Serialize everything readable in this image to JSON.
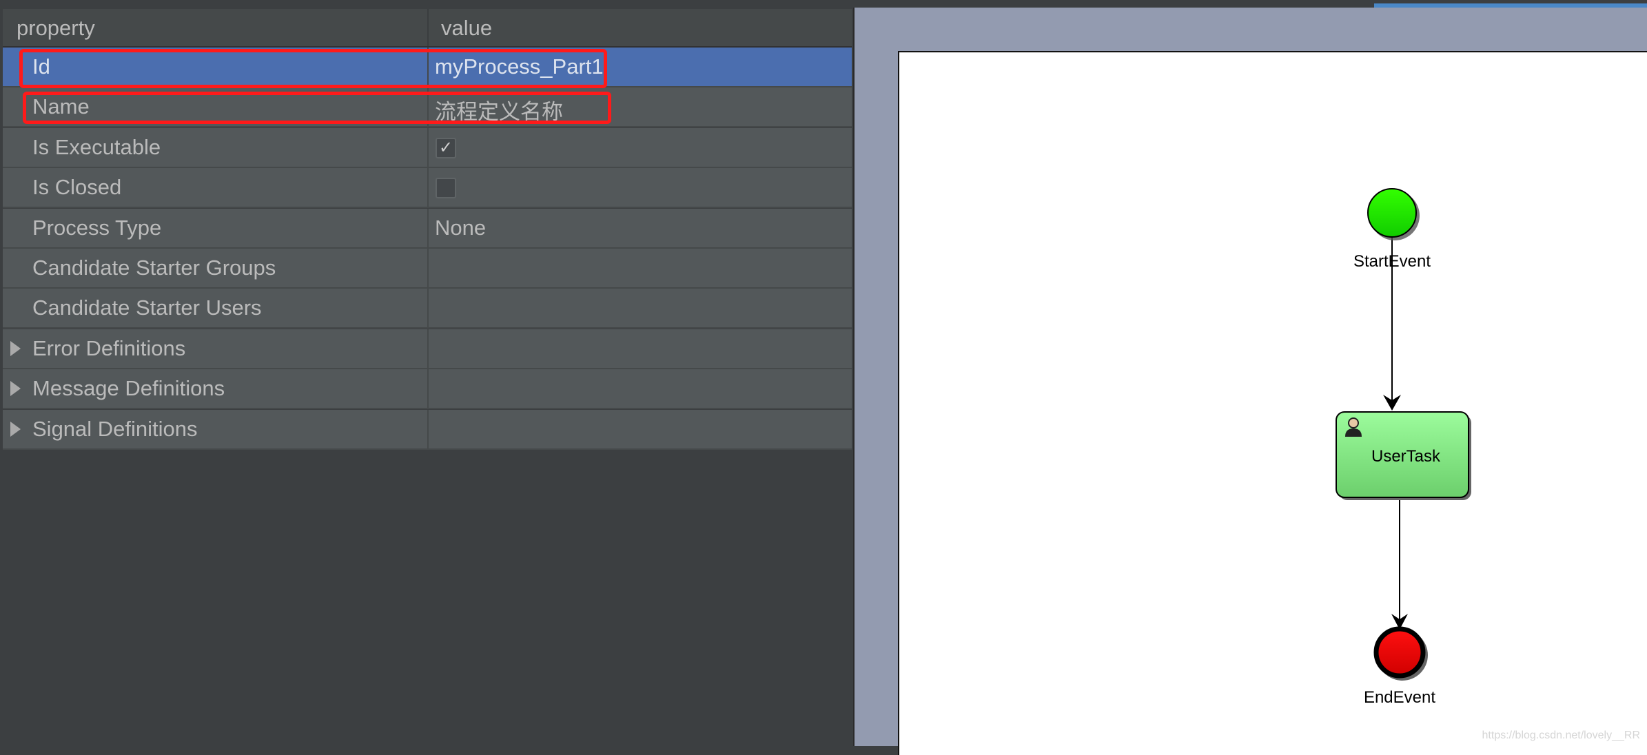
{
  "table": {
    "headers": {
      "property": "property",
      "value": "value"
    },
    "rows": [
      {
        "property": "Id",
        "value": "myProcess_Part1",
        "selected": true,
        "highlighted": true
      },
      {
        "property": "Name",
        "value": "流程定义名称",
        "highlighted": true
      },
      {
        "property": "Is Executable",
        "checkbox": true,
        "checked": true
      },
      {
        "property": "Is Closed",
        "checkbox": true,
        "checked": false
      },
      {
        "property": "Process Type",
        "value": "None"
      },
      {
        "property": "Candidate Starter Groups",
        "value": ""
      },
      {
        "property": "Candidate Starter Users",
        "value": ""
      },
      {
        "property": "Error Definitions",
        "expandable": true
      },
      {
        "property": "Message Definitions",
        "expandable": true
      },
      {
        "property": "Signal Definitions",
        "expandable": true
      }
    ]
  },
  "diagram": {
    "nodes": [
      {
        "id": "start",
        "type": "start-event",
        "label": "StartEvent",
        "color": "#22ee00"
      },
      {
        "id": "task",
        "type": "user-task",
        "label": "UserTask",
        "color": "#88e888",
        "icon": "user-icon"
      },
      {
        "id": "end",
        "type": "end-event",
        "label": "EndEvent",
        "color": "#e60000"
      }
    ],
    "edges": [
      {
        "from": "start",
        "to": "task"
      },
      {
        "from": "task",
        "to": "end"
      }
    ]
  },
  "watermark": "https://blog.csdn.net/lovely__RR",
  "colors": {
    "selection": "#4b6eaf",
    "highlight_box": "#ff1a1a"
  }
}
